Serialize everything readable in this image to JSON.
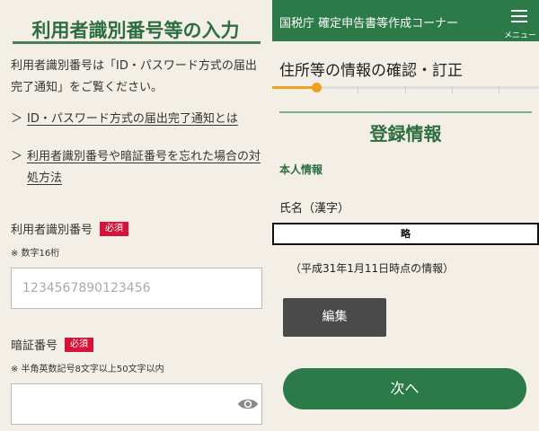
{
  "left": {
    "title": "利用者識別番号等の入力",
    "description": "利用者識別番号は「ID・パスワード方式の届出完了通知」をご覧ください。",
    "links": [
      {
        "label": "ID・パスワード方式の届出完了通知とは"
      },
      {
        "label": "利用者識別番号や暗証番号を忘れた場合の対処方法"
      }
    ],
    "user_id_field": {
      "label": "利用者識別番号",
      "required_badge": "必須",
      "note": "※ 数字16桁",
      "placeholder": "1234567890123456"
    },
    "password_field": {
      "label": "暗証番号",
      "required_badge": "必須",
      "note": "※ 半角英数記号8文字以上50文字以内",
      "placeholder": ""
    },
    "chevron_glyph": "＞"
  },
  "right": {
    "header": {
      "title": "国税庁 確定申告書等作成コーナー",
      "menu_label": "メニュー"
    },
    "step_title": "住所等の情報の確認・訂正",
    "progress": {
      "current_step": 1,
      "total_steps": 6,
      "fraction": 0.15
    },
    "section_title": "登録情報",
    "subsection": "本人情報",
    "name_label": "氏名（漢字）",
    "name_value": "略",
    "date_note": "（平成31年1月11日時点の情報）",
    "edit_button": "編集",
    "next_button": "次へ"
  },
  "colors": {
    "brand_green": "#2c7a47",
    "heading_green": "#2c6e3f",
    "required_red": "#d4143b",
    "progress_orange": "#f0a020",
    "background": "#f3efe6"
  },
  "icons": {
    "password_toggle": "eye-icon",
    "menu": "hamburger-icon"
  }
}
